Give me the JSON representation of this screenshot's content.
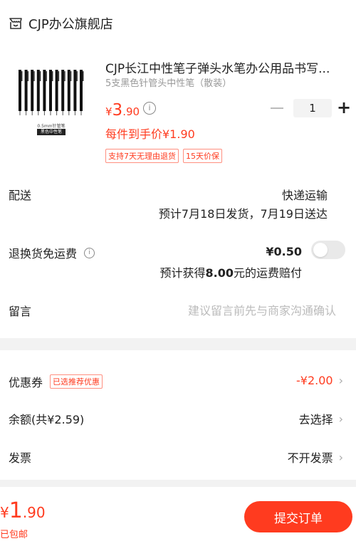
{
  "store": {
    "name": "CJP办公旗舰店",
    "icon": "store-icon"
  },
  "product": {
    "title": "CJP长江中性笔子弹头水笔办公用品书写...",
    "spec": "5支黑色针管头中性笔（散装）",
    "image_caption": "0.5mm针管笔",
    "image_label": "黑色中性笔",
    "price_currency": "¥",
    "price_int": "3",
    "price_dec": ".90",
    "quantity": "1",
    "promo_price": "每件到手价¥1.90",
    "tags": [
      "支持7天无理由退货",
      "15天价保"
    ]
  },
  "delivery": {
    "label": "配送",
    "method": "快递运输",
    "estimate": "预计7月18日发货，7月19日送达"
  },
  "return_insurance": {
    "label": "退换货免运费",
    "price": "¥0.50",
    "desc_prefix": "预计获得",
    "amount": "8.00",
    "desc_suffix": "元的运费赔付",
    "enabled": false
  },
  "note": {
    "label": "留言",
    "placeholder": "建议留言前先与商家沟通确认"
  },
  "coupon": {
    "label": "优惠券",
    "badge": "已选推荐优惠",
    "value": "-¥2.00"
  },
  "balance": {
    "label": "余额(共¥2.59)",
    "action": "去选择"
  },
  "invoice": {
    "label": "发票",
    "value": "不开发票"
  },
  "footer": {
    "total_currency": "¥",
    "total_int": "1",
    "total_dec": ".90",
    "shipping_note": "已包邮",
    "submit_label": "提交订单"
  },
  "colors": {
    "accent": "#ff3b1f",
    "background": "#f2f2f2"
  }
}
